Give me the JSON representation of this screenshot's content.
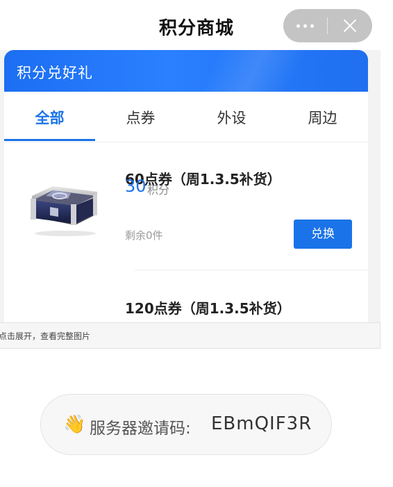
{
  "header": {
    "title": "积分商城"
  },
  "banner": {
    "title": "积分兑好礼"
  },
  "tabs": [
    {
      "label": "全部",
      "active": true
    },
    {
      "label": "点券",
      "active": false
    },
    {
      "label": "外设",
      "active": false
    },
    {
      "label": "周边",
      "active": false
    }
  ],
  "items": [
    {
      "title": "60点券（周1.3.5补货）",
      "price": "30",
      "price_unit": "积分",
      "stock": "剩余0件",
      "button": "兑换",
      "icon": "treasure-chest-icon"
    },
    {
      "title": "120点券（周1.3.5补货）",
      "icon": "treasure-chest-icon"
    }
  ],
  "expand": {
    "label": "点击展开，查看完整图片"
  },
  "invite": {
    "label": "服务器邀请码:",
    "code": "EBmQIF3R",
    "icon": "waving-hand-icon"
  },
  "colors": {
    "accent": "#1a73e8",
    "capsule": "#c4c4c4"
  }
}
